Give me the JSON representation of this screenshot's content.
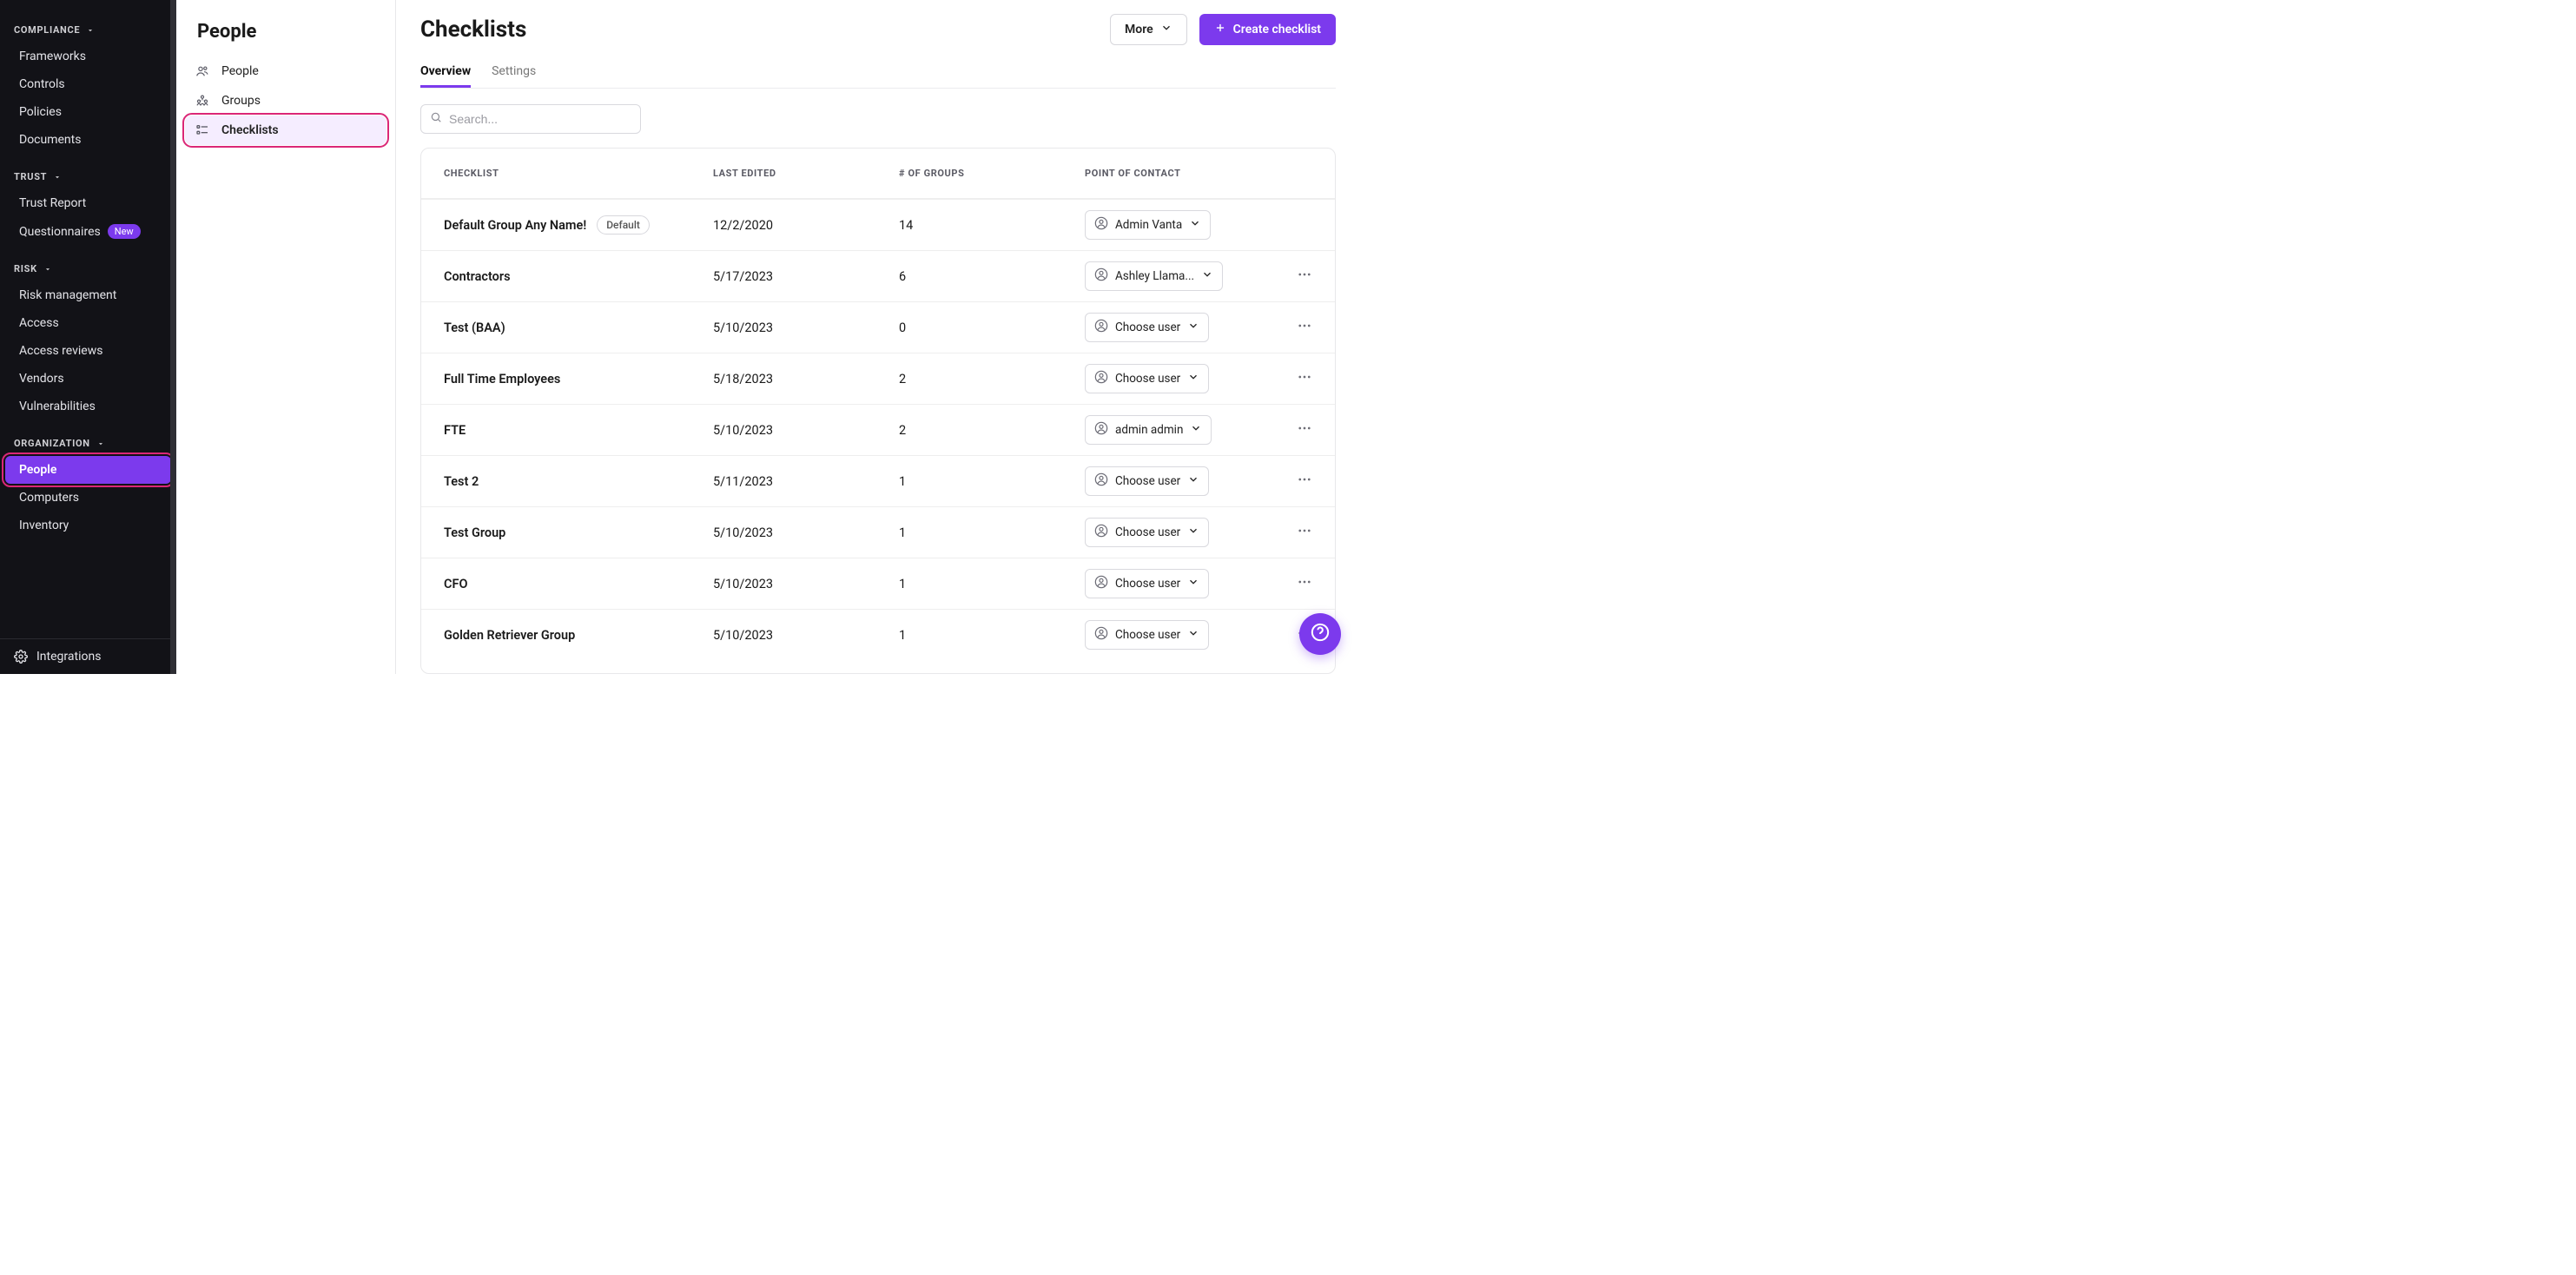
{
  "sidebar_left": {
    "sections": [
      {
        "title": "COMPLIANCE",
        "items": [
          {
            "label": "Frameworks"
          },
          {
            "label": "Controls"
          },
          {
            "label": "Policies"
          },
          {
            "label": "Documents"
          }
        ]
      },
      {
        "title": "TRUST",
        "items": [
          {
            "label": "Trust Report"
          },
          {
            "label": "Questionnaires",
            "badge": "New"
          }
        ]
      },
      {
        "title": "RISK",
        "items": [
          {
            "label": "Risk management"
          },
          {
            "label": "Access"
          },
          {
            "label": "Access reviews"
          },
          {
            "label": "Vendors"
          },
          {
            "label": "Vulnerabilities"
          }
        ]
      },
      {
        "title": "ORGANIZATION",
        "items": [
          {
            "label": "People",
            "active": true,
            "callout": true
          },
          {
            "label": "Computers"
          },
          {
            "label": "Inventory"
          }
        ]
      }
    ],
    "footer": {
      "label": "Integrations"
    }
  },
  "sidebar_second": {
    "title": "People",
    "items": [
      {
        "label": "People",
        "icon": "people"
      },
      {
        "label": "Groups",
        "icon": "groups"
      },
      {
        "label": "Checklists",
        "icon": "checklist",
        "selected": true,
        "callout": true
      }
    ]
  },
  "main": {
    "title": "Checklists",
    "more_label": "More",
    "create_label": "Create checklist",
    "tabs": [
      {
        "label": "Overview",
        "active": true
      },
      {
        "label": "Settings"
      }
    ],
    "search_placeholder": "Search...",
    "columns": [
      "CHECKLIST",
      "LAST EDITED",
      "# OF GROUPS",
      "POINT OF CONTACT"
    ],
    "default_badge_label": "Default",
    "choose_user_label": "Choose user",
    "rows": [
      {
        "name": "Default Group Any Name!",
        "is_default": true,
        "last_edited": "12/2/2020",
        "groups": "14",
        "poc": "Admin Vanta",
        "row_actions": false
      },
      {
        "name": "Contractors",
        "last_edited": "5/17/2023",
        "groups": "6",
        "poc": "Ashley Llama...",
        "row_actions": true
      },
      {
        "name": "Test (BAA)",
        "last_edited": "5/10/2023",
        "groups": "0",
        "poc": null,
        "row_actions": true
      },
      {
        "name": "Full Time Employees",
        "last_edited": "5/18/2023",
        "groups": "2",
        "poc": null,
        "row_actions": true
      },
      {
        "name": "FTE",
        "last_edited": "5/10/2023",
        "groups": "2",
        "poc": "admin admin",
        "row_actions": true
      },
      {
        "name": "Test 2",
        "last_edited": "5/11/2023",
        "groups": "1",
        "poc": null,
        "row_actions": true
      },
      {
        "name": "Test Group",
        "last_edited": "5/10/2023",
        "groups": "1",
        "poc": null,
        "row_actions": true
      },
      {
        "name": "CFO",
        "last_edited": "5/10/2023",
        "groups": "1",
        "poc": null,
        "row_actions": true
      },
      {
        "name": "Golden Retriever Group",
        "last_edited": "5/10/2023",
        "groups": "1",
        "poc": null,
        "row_actions": true
      }
    ]
  }
}
